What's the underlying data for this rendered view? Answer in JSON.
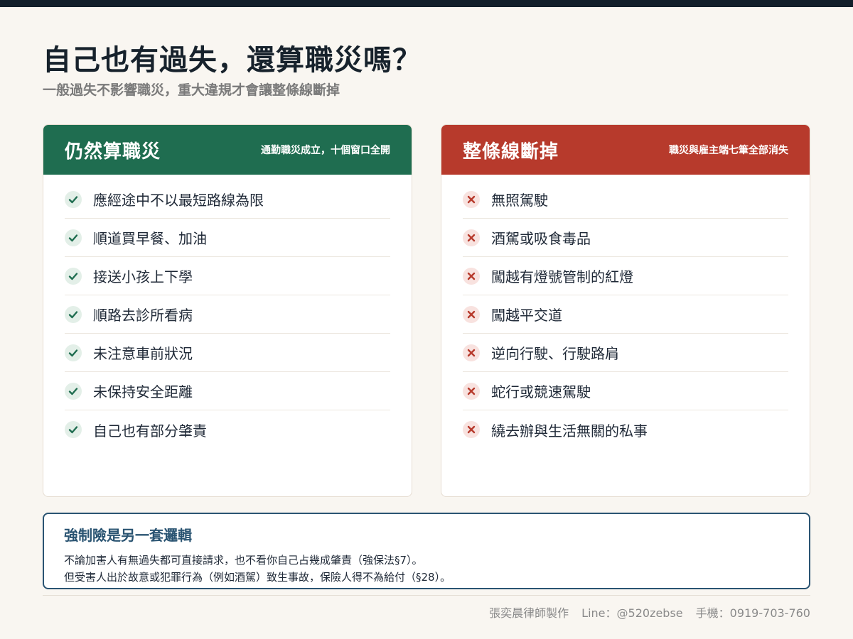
{
  "title": "自己也有過失，還算職災嗎？",
  "subtitle": "一般過失不影響職災，重大違規才會讓整條線斷掉",
  "colors": {
    "background": "#f9f6f1",
    "topbar": "#13202b",
    "green": "#1f6d50",
    "red": "#b73a2c",
    "navy": "#2a5472"
  },
  "left_card": {
    "title": "仍然算職災",
    "note": "通勤職災成立，十個窗口全開",
    "icon": "check-icon",
    "items": [
      "應經途中不以最短路線為限",
      "順道買早餐、加油",
      "接送小孩上下學",
      "順路去診所看病",
      "未注意車前狀況",
      "未保持安全距離",
      "自己也有部分肇責"
    ]
  },
  "right_card": {
    "title": "整條線斷掉",
    "note": "職災與雇主端七筆全部消失",
    "icon": "cross-icon",
    "items": [
      "無照駕駛",
      "酒駕或吸食毒品",
      "闖越有燈號管制的紅燈",
      "闖越平交道",
      "逆向行駛、行駛路肩",
      "蛇行或競速駕駛",
      "繞去辦與生活無關的私事"
    ]
  },
  "callout": {
    "title": "強制險是另一套邏輯",
    "line1": "不論加害人有無過失都可直接請求，也不看你自己占幾成肇責（強保法§7）。",
    "line2": "但受害人出於故意或犯罪行為（例如酒駕）致生事故，保險人得不為給付（§28）。"
  },
  "footer": {
    "author": "張奕晨律師製作",
    "line": "Line：@520zebse",
    "phone": "手機：0919-703-760"
  }
}
